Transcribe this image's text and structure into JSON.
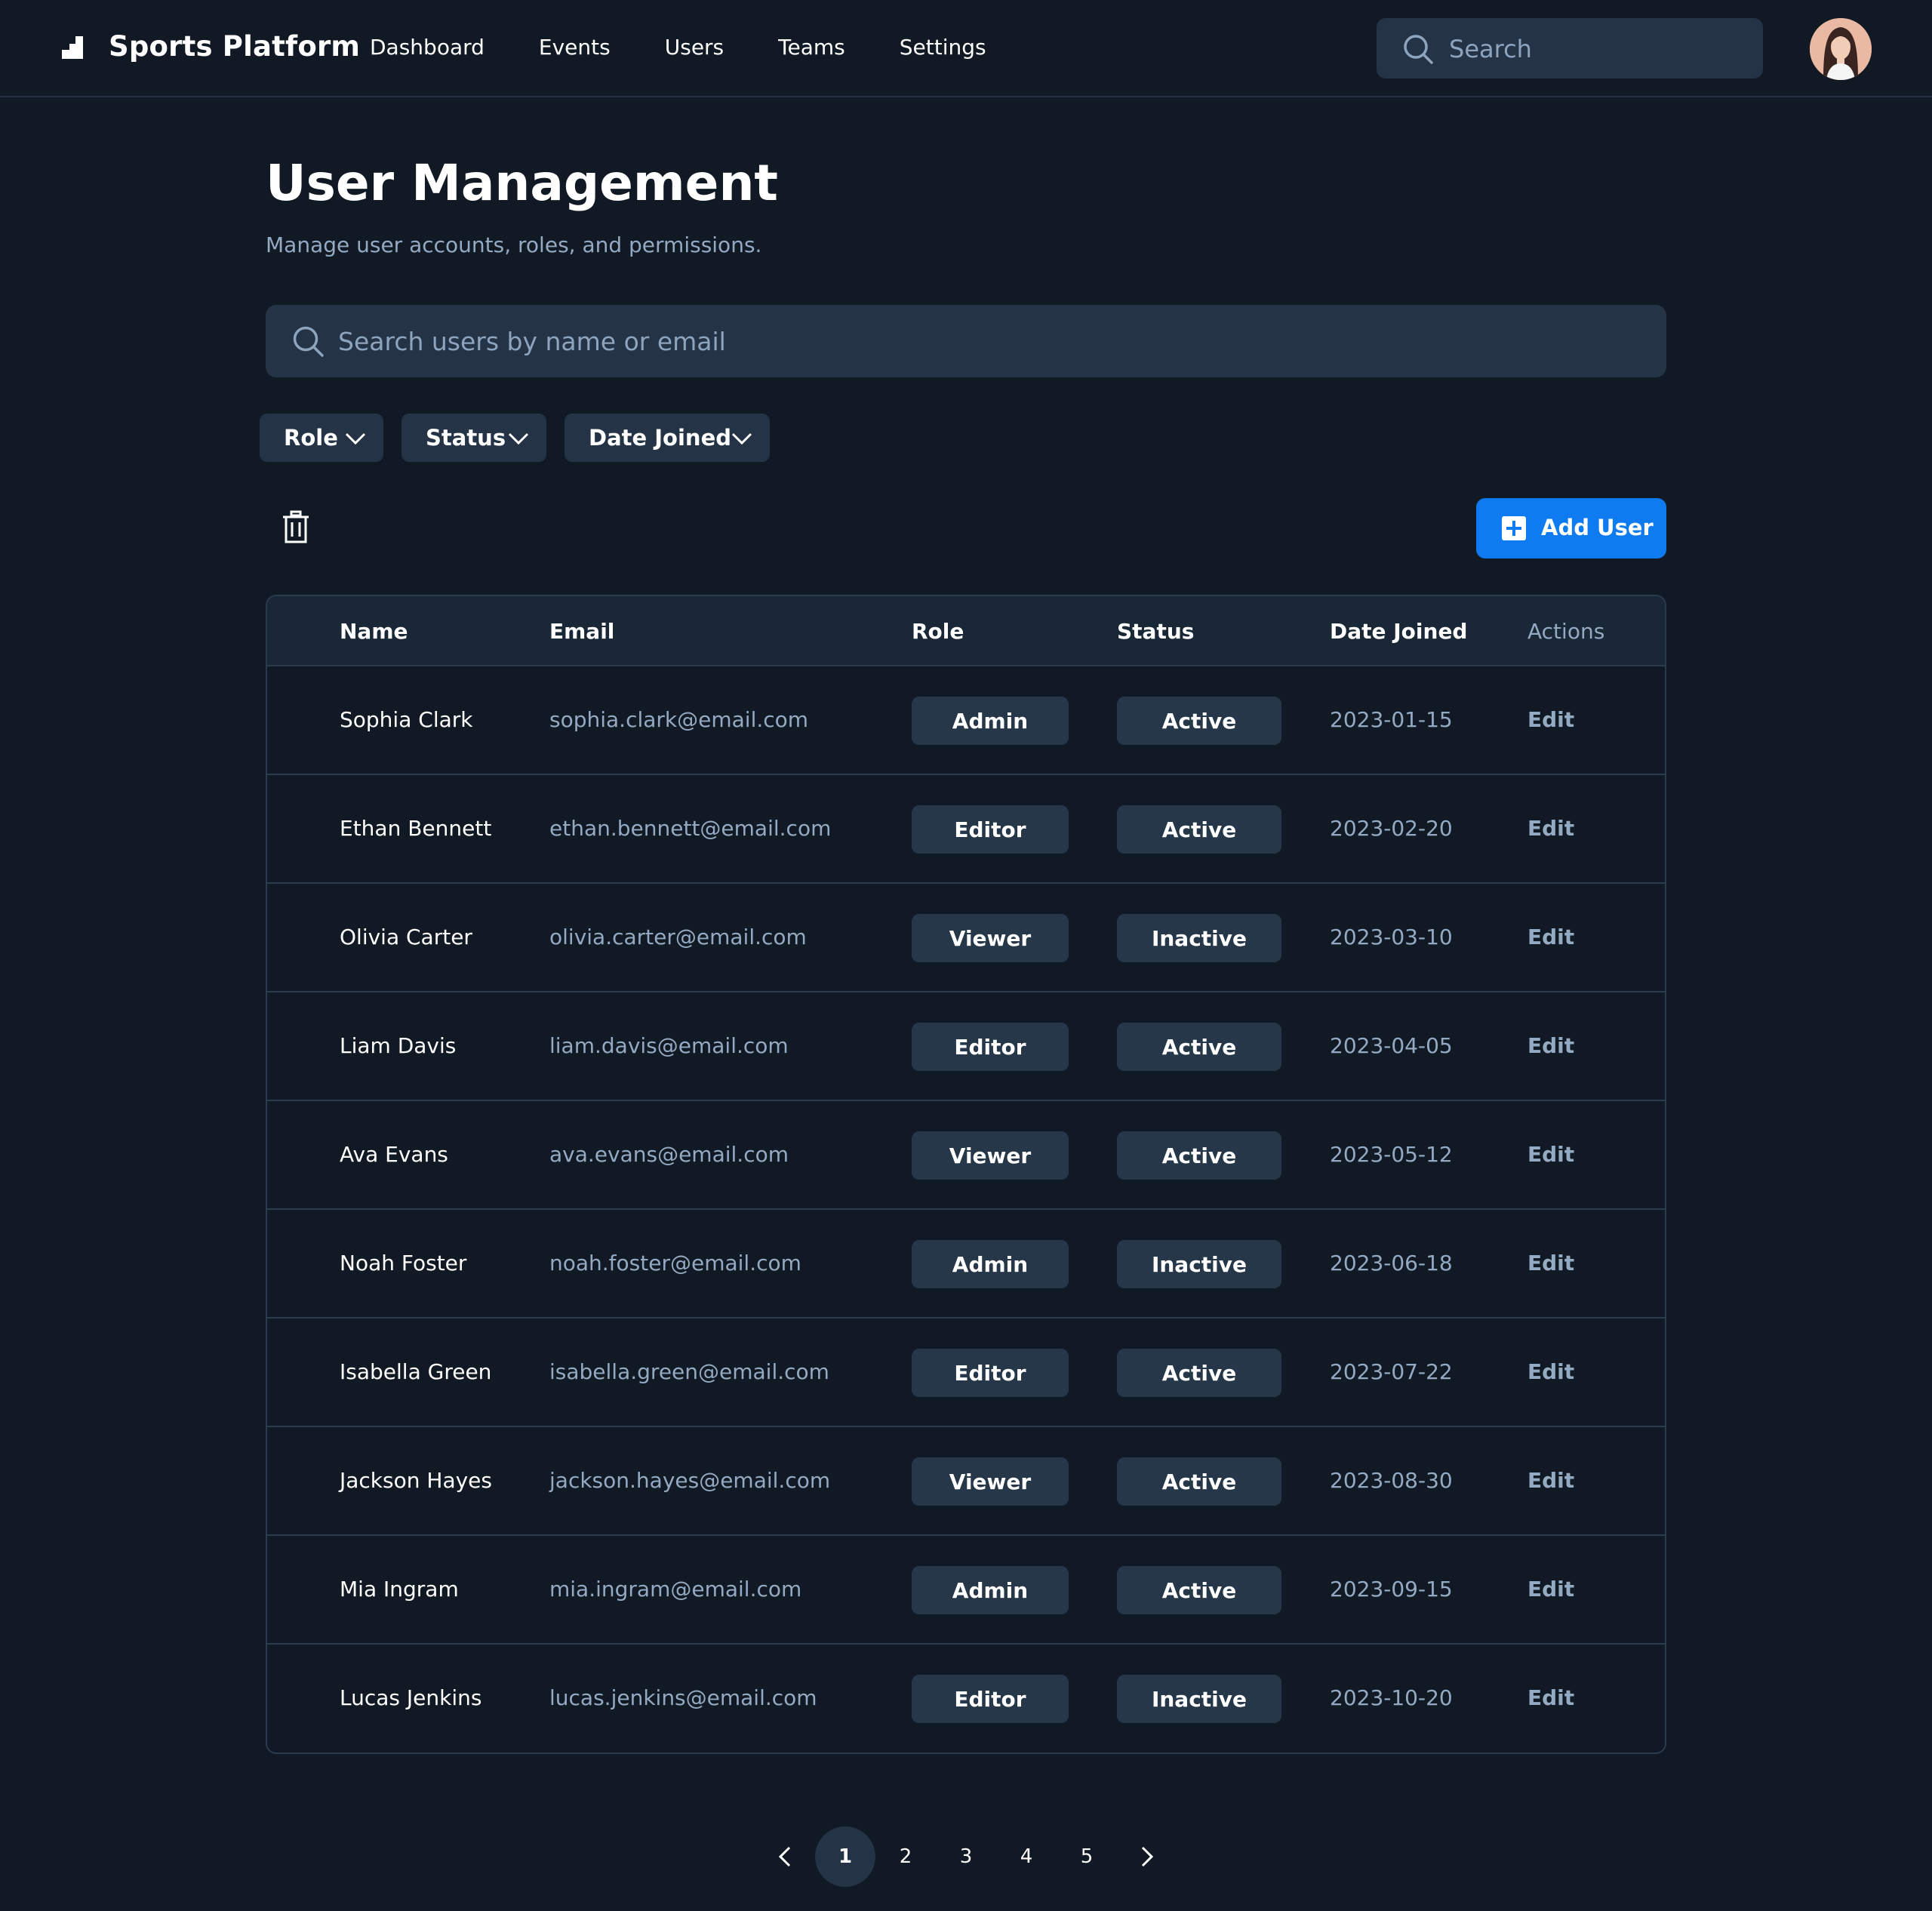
{
  "header": {
    "brand": "Sports Platform",
    "nav": [
      "Dashboard",
      "Events",
      "Users",
      "Teams",
      "Settings"
    ],
    "search_placeholder": "Search"
  },
  "page": {
    "title": "User Management",
    "subtitle": "Manage user accounts, roles, and permissions.",
    "search_placeholder": "Search users by name or email",
    "filters": [
      "Role",
      "Status",
      "Date Joined"
    ],
    "add_user_label": "Add User"
  },
  "table": {
    "columns": [
      "Name",
      "Email",
      "Role",
      "Status",
      "Date Joined",
      "Actions"
    ],
    "rows": [
      {
        "name": "Sophia Clark",
        "email": "sophia.clark@email.com",
        "role": "Admin",
        "status": "Active",
        "date": "2023-01-15",
        "action": "Edit"
      },
      {
        "name": "Ethan Bennett",
        "email": "ethan.bennett@email.com",
        "role": "Editor",
        "status": "Active",
        "date": "2023-02-20",
        "action": "Edit"
      },
      {
        "name": "Olivia Carter",
        "email": "olivia.carter@email.com",
        "role": "Viewer",
        "status": "Inactive",
        "date": "2023-03-10",
        "action": "Edit"
      },
      {
        "name": "Liam Davis",
        "email": "liam.davis@email.com",
        "role": "Editor",
        "status": "Active",
        "date": "2023-04-05",
        "action": "Edit"
      },
      {
        "name": "Ava Evans",
        "email": "ava.evans@email.com",
        "role": "Viewer",
        "status": "Active",
        "date": "2023-05-12",
        "action": "Edit"
      },
      {
        "name": "Noah Foster",
        "email": "noah.foster@email.com",
        "role": "Admin",
        "status": "Inactive",
        "date": "2023-06-18",
        "action": "Edit"
      },
      {
        "name": "Isabella Green",
        "email": "isabella.green@email.com",
        "role": "Editor",
        "status": "Active",
        "date": "2023-07-22",
        "action": "Edit"
      },
      {
        "name": "Jackson Hayes",
        "email": "jackson.hayes@email.com",
        "role": "Viewer",
        "status": "Active",
        "date": "2023-08-30",
        "action": "Edit"
      },
      {
        "name": "Mia Ingram",
        "email": "mia.ingram@email.com",
        "role": "Admin",
        "status": "Active",
        "date": "2023-09-15",
        "action": "Edit"
      },
      {
        "name": "Lucas Jenkins",
        "email": "lucas.jenkins@email.com",
        "role": "Editor",
        "status": "Inactive",
        "date": "2023-10-20",
        "action": "Edit"
      }
    ]
  },
  "pagination": {
    "pages": [
      "1",
      "2",
      "3",
      "4",
      "5"
    ],
    "current": "1"
  },
  "colors": {
    "background": "#111a24",
    "panel": "#243446",
    "accent": "#0f7bf0",
    "muted_text": "#94a9c2"
  }
}
